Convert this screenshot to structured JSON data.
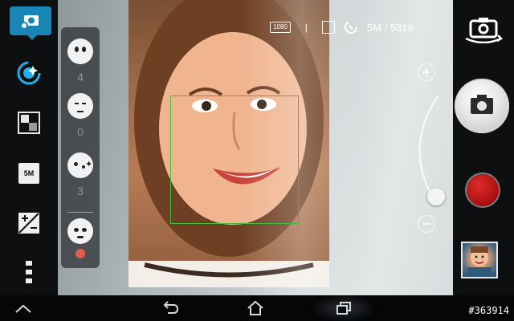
{
  "status_bar": {
    "video_quality": "1080",
    "separator": "|",
    "resolution_counter": "5M / 5316"
  },
  "left_rail": {
    "items": [
      "camera-mode-icon",
      "beautification-icon",
      "effect-icon",
      "resolution-icon",
      "exposure-icon",
      "more-icon"
    ],
    "resolution_label": "5M"
  },
  "beauty_panel": {
    "options": [
      {
        "value": "4"
      },
      {
        "value": "0"
      },
      {
        "value": "3"
      },
      {
        "value": ""
      }
    ]
  },
  "colors": {
    "accent": "#1a86b5",
    "face_box": "#35c13a",
    "record": "#c81a1a",
    "active_dot": "#e35d4e"
  },
  "watermark": "#363914"
}
